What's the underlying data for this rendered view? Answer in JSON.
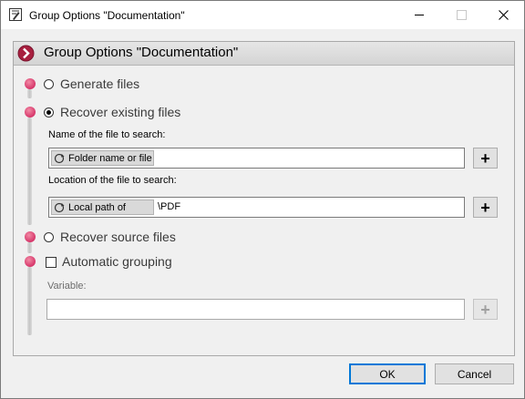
{
  "window": {
    "title": "Group Options \"Documentation\"",
    "app_icon": "document-pen-icon",
    "controls": [
      "minimize-icon",
      "maximize-icon",
      "close-icon"
    ]
  },
  "panel": {
    "title": "Group Options \"Documentation\"",
    "header_icon": "chevron-right-icon",
    "accent_color": "#c8284f"
  },
  "options": {
    "generate_files": {
      "label": "Generate files",
      "selected": false
    },
    "recover_existing": {
      "label": "Recover existing files",
      "selected": true,
      "file_name_label": "Name of the file to search:",
      "file_name_chip": "Folder name or file",
      "file_name_value": "",
      "location_label": "Location of the file to search:",
      "location_chip": "Local path of",
      "location_value": "\\PDF",
      "add_label": "+"
    },
    "recover_source": {
      "label": "Recover source files",
      "selected": false
    },
    "automatic_grouping": {
      "label": "Automatic grouping",
      "checked": false,
      "variable_label": "Variable:",
      "variable_value": "",
      "add_label": "+"
    }
  },
  "buttons": {
    "ok": "OK",
    "cancel": "Cancel"
  },
  "colors": {
    "dot": "#d6366a",
    "default_button_border": "#0078d7"
  }
}
